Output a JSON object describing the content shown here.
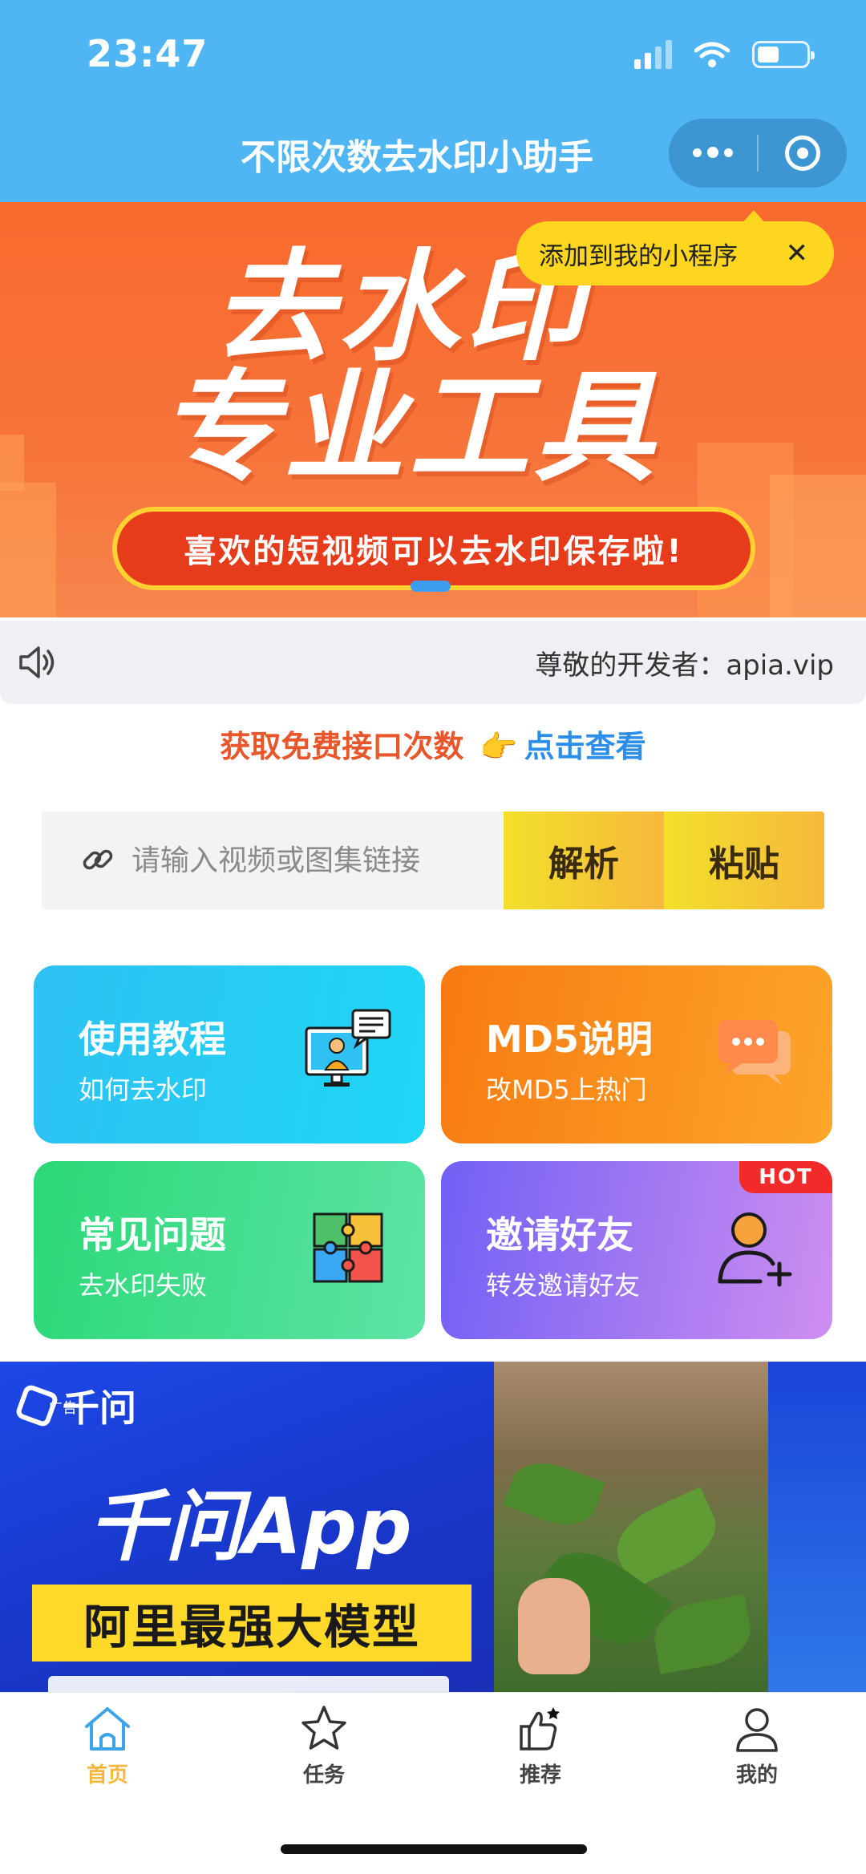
{
  "status_bar": {
    "time": "23:47",
    "battery_level": 0.45
  },
  "nav": {
    "title": "不限次数去水印小助手"
  },
  "banner": {
    "title_line1": "去水印",
    "title_line2": "专业工具",
    "pill_text": "喜欢的短视频可以去水印保存啦!",
    "add_tip": "添加到我的小程序"
  },
  "notice": {
    "text": "尊敬的开发者：apia.vip"
  },
  "free_link": {
    "prefix": "获取免费接口次数",
    "link": "点击查看"
  },
  "input": {
    "placeholder": "请输入视频或图集链接",
    "parse_label": "解析",
    "paste_label": "粘贴"
  },
  "cards": [
    {
      "title": "使用教程",
      "sub": "如何去水印"
    },
    {
      "title": "MD5说明",
      "sub": "改MD5上热门"
    },
    {
      "title": "常见问题",
      "sub": "去水印失败"
    },
    {
      "title": "邀请好友",
      "sub": "转发邀请好友",
      "badge": "HOT"
    }
  ],
  "ad": {
    "brand": "千问",
    "ad_tag": "广告",
    "app": "千问App",
    "slogan": "阿里最强大模型"
  },
  "tabs": [
    {
      "label": "首页",
      "icon": "home-icon"
    },
    {
      "label": "任务",
      "icon": "star-icon"
    },
    {
      "label": "推荐",
      "icon": "thumbs-up-icon"
    },
    {
      "label": "我的",
      "icon": "person-icon"
    }
  ],
  "colors": {
    "nav_bg": "#4fb6f3",
    "tab_active": "#f5b73b",
    "accent_yellow": "#ffd61f"
  }
}
